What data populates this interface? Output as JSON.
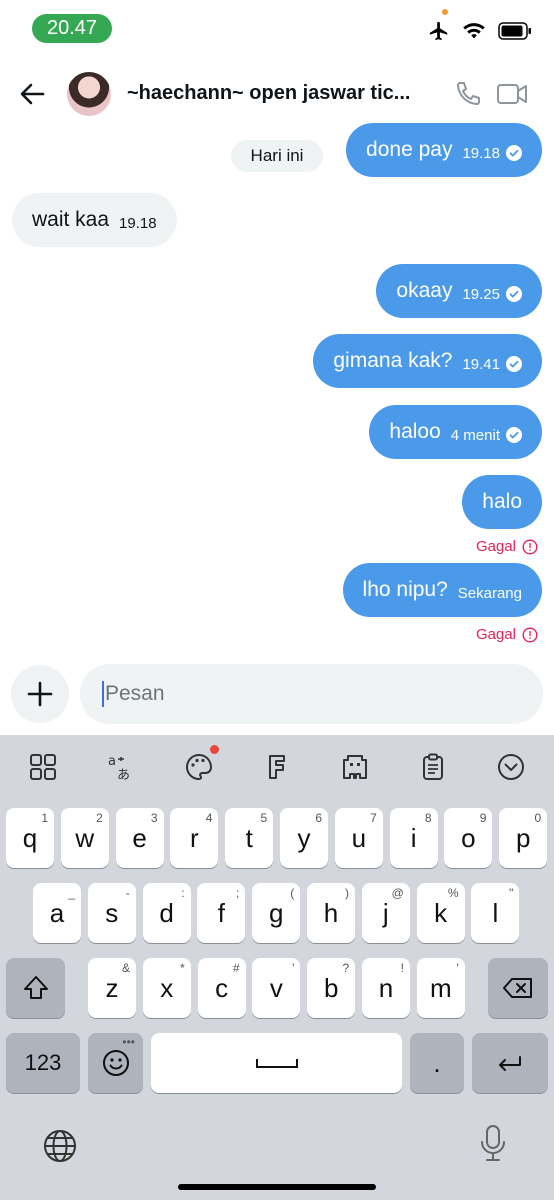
{
  "status_bar": {
    "time": "20.47"
  },
  "header": {
    "title": "~haechann~ open jaswar tic..."
  },
  "date_chip": "Hari ini",
  "messages": [
    {
      "text": "done pay",
      "time": "19.18",
      "dir": "out"
    },
    {
      "text": "wait kaa",
      "time": "19.18",
      "dir": "in"
    },
    {
      "text": "okaay",
      "time": "19.25",
      "dir": "out"
    },
    {
      "text": "gimana kak?",
      "time": "19.41",
      "dir": "out"
    },
    {
      "text": "haloo",
      "time": "4 menit",
      "dir": "out"
    },
    {
      "text": "halo",
      "time": "",
      "dir": "out",
      "status": "Gagal"
    },
    {
      "text": "lho nipu?",
      "time": "Sekarang",
      "dir": "out",
      "status": "Gagal"
    }
  ],
  "composer": {
    "placeholder": "Pesan"
  },
  "keyboard": {
    "row1": [
      [
        "q",
        "1"
      ],
      [
        "w",
        "2"
      ],
      [
        "e",
        "3"
      ],
      [
        "r",
        "4"
      ],
      [
        "t",
        "5"
      ],
      [
        "y",
        "6"
      ],
      [
        "u",
        "7"
      ],
      [
        "i",
        "8"
      ],
      [
        "o",
        "9"
      ],
      [
        "p",
        "0"
      ]
    ],
    "row2": [
      [
        "a",
        "_"
      ],
      [
        "s",
        "-"
      ],
      [
        "d",
        ":"
      ],
      [
        "f",
        ";"
      ],
      [
        "g",
        "("
      ],
      [
        "h",
        ")"
      ],
      [
        "j",
        "@"
      ],
      [
        "k",
        "%"
      ],
      [
        "l",
        "\""
      ]
    ],
    "row3": [
      [
        "z",
        "&"
      ],
      [
        "x",
        "*"
      ],
      [
        "c",
        "#"
      ],
      [
        "v",
        "'"
      ],
      [
        "b",
        "?"
      ],
      [
        "n",
        "!"
      ],
      [
        "m",
        "'"
      ]
    ],
    "numbers_label": "123",
    "period_label": "."
  },
  "colors": {
    "outgoing_bubble": "#4a9ae9",
    "incoming_bubble": "#eff3f4",
    "failed": "#e0245e",
    "status_time_pill": "#35a853"
  }
}
